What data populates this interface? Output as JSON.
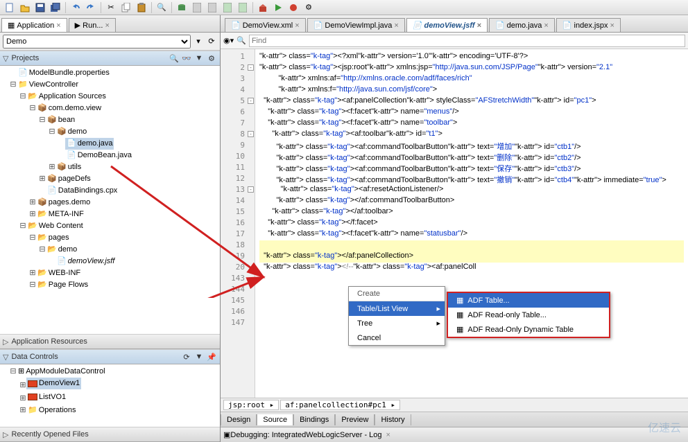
{
  "toolbar_icons": [
    "new",
    "open",
    "save",
    "save-all",
    "undo",
    "redo",
    "cut",
    "copy",
    "paste",
    "find",
    "db1",
    "db2",
    "db3",
    "db4",
    "db5",
    "run",
    "debug",
    "cfg",
    "more"
  ],
  "left_tabs": [
    {
      "icon": "app",
      "label": "Application"
    },
    {
      "icon": "run",
      "label": "Run..."
    }
  ],
  "project_combo": "Demo",
  "sections": {
    "projects": {
      "title": "Projects"
    },
    "app_res": {
      "title": "Application Resources"
    },
    "data_controls": {
      "title": "Data Controls"
    },
    "recent": {
      "title": "Recently Opened Files"
    }
  },
  "project_tree": {
    "model_bundle": "ModelBundle.properties",
    "vc": "ViewController",
    "app_src": "Application Sources",
    "pkg1": "com.demo.view",
    "bean": "bean",
    "demo_pkg": "demo",
    "demo_java": "demo.java",
    "demobean": "DemoBean.java",
    "utils": "utils",
    "pagedefs": "pageDefs",
    "databindings": "DataBindings.cpx",
    "pages_demo": "pages.demo",
    "meta_inf": "META-INF",
    "web_content": "Web Content",
    "pages": "pages",
    "demo_folder": "demo",
    "demoview": "demoView.jsff",
    "web_inf": "WEB-INF",
    "page_flows": "Page Flows"
  },
  "data_controls_tree": {
    "root": "AppModuleDataControl",
    "demoview1": "DemoView1",
    "listvo1": "ListVO1",
    "operations": "Operations"
  },
  "editor_tabs": [
    {
      "label": "DemoView.xml",
      "active": false
    },
    {
      "label": "DemoViewImpl.java",
      "active": false
    },
    {
      "label": "demoView.jsff",
      "active": true
    },
    {
      "label": "demo.java",
      "active": false
    },
    {
      "label": "index.jspx",
      "active": false
    }
  ],
  "find_placeholder": "Find",
  "code_lines": [
    "<?xml version='1.0' encoding='UTF-8'?>",
    "<jsp:root xmlns:jsp=\"http://java.sun.com/JSP/Page\" version=\"2.1\"",
    "          xmlns:af=\"http://xmlns.oracle.com/adf/faces/rich\"",
    "          xmlns:f=\"http://java.sun.com/jsf/core\">",
    "  <af:panelCollection styleClass=\"AFStretchWidth\" id=\"pc1\">",
    "    <f:facet name=\"menus\"/>",
    "    <f:facet name=\"toolbar\">",
    "      <af:toolbar id=\"t1\">",
    "        <af:commandToolbarButton text=\"增加\" id=\"ctb1\"/>",
    "        <af:commandToolbarButton text=\"删除\" id=\"ctb2\"/>",
    "        <af:commandToolbarButton text=\"保存\" id=\"ctb3\"/>",
    "        <af:commandToolbarButton text=\"撤销\" id=\"ctb4\" immediate=\"true\">",
    "          <af:resetActionListener/>",
    "        </af:commandToolbarButton>",
    "      </af:toolbar>",
    "    </f:facet>",
    "    <f:facet name=\"statusbar\"/>",
    "",
    "  </af:panelCollection>",
    "  <!--<af:panelColl",
    "",
    "",
    "",
    "",
    ""
  ],
  "line_numbers": [
    1,
    2,
    3,
    4,
    5,
    6,
    7,
    8,
    9,
    10,
    11,
    12,
    13,
    14,
    15,
    16,
    17,
    18,
    19,
    20,
    143,
    144,
    145,
    146,
    147
  ],
  "breadcrumb": [
    "jsp:root ▸",
    "af:panelcollection#pc1 ▸"
  ],
  "bottom_tabs": [
    "Design",
    "Source",
    "Bindings",
    "Preview",
    "History"
  ],
  "bottom_active": "Source",
  "debug_bar": "Debugging: IntegratedWebLogicServer - Log",
  "context_menu": {
    "header": "Create",
    "items": [
      {
        "label": "Table/List View",
        "hover": true,
        "has_sub": true
      },
      {
        "label": "Tree",
        "hover": false,
        "has_sub": true
      },
      {
        "label": "Cancel",
        "hover": false,
        "has_sub": false
      }
    ]
  },
  "submenu": [
    {
      "label": "ADF Table...",
      "hover": true
    },
    {
      "label": "ADF Read-only Table...",
      "hover": false
    },
    {
      "label": "ADF Read-Only Dynamic Table",
      "hover": false
    }
  ],
  "watermark": "亿速云"
}
